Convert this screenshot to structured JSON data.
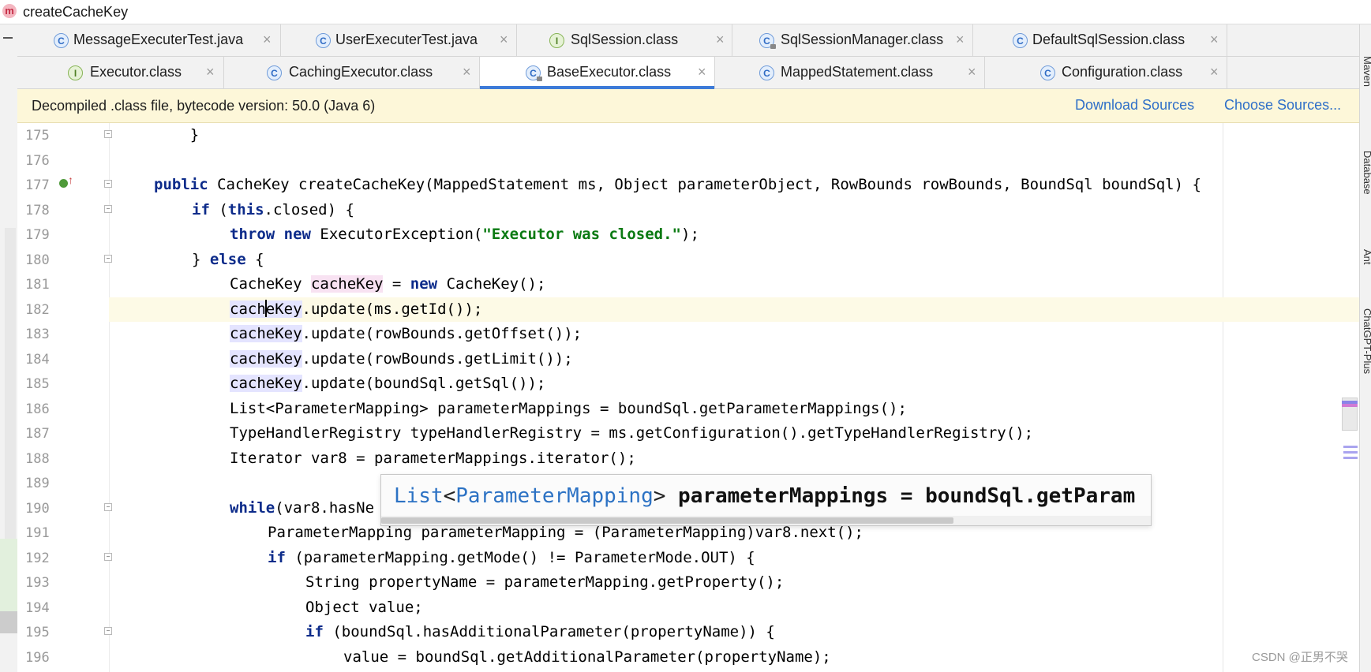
{
  "breadcrumb": {
    "icon_letter": "m",
    "text": "createCacheKey"
  },
  "tab_row_1": [
    {
      "label": "MessageExecuterTest.java",
      "icon": "c",
      "close": "×"
    },
    {
      "label": "UserExecuterTest.java",
      "icon": "c",
      "close": "×"
    },
    {
      "label": "SqlSession.class",
      "icon": "i",
      "close": "×"
    },
    {
      "label": "SqlSessionManager.class",
      "icon": "c",
      "close": "×"
    },
    {
      "label": "DefaultSqlSession.class",
      "icon": "c",
      "close": "×"
    }
  ],
  "tab_row_2": [
    {
      "label": "Executor.class",
      "icon": "i",
      "close": "×"
    },
    {
      "label": "CachingExecutor.class",
      "icon": "c",
      "close": "×"
    },
    {
      "label": "BaseExecutor.class",
      "icon": "c",
      "close": "×",
      "active": true
    },
    {
      "label": "MappedStatement.class",
      "icon": "c",
      "close": "×"
    },
    {
      "label": "Configuration.class",
      "icon": "c",
      "close": "×"
    }
  ],
  "banner": {
    "text": "Decompiled .class file, bytecode version: 50.0 (Java 6)",
    "download_sources": "Download Sources",
    "choose_sources": "Choose Sources..."
  },
  "right_tools": [
    "Maven",
    "Database",
    "Ant",
    "ChatGPT-Plus"
  ],
  "line_numbers": [
    "175",
    "176",
    "177",
    "178",
    "179",
    "180",
    "181",
    "182",
    "183",
    "184",
    "185",
    "186",
    "187",
    "188",
    "189",
    "190",
    "191",
    "192",
    "193",
    "194",
    "195",
    "196"
  ],
  "code": {
    "l175": "    }",
    "l177_kw": "public",
    "l177_rest": " CacheKey createCacheKey(MappedStatement ms, Object parameterObject, RowBounds rowBounds, BoundSql boundSql) {",
    "l178_kw1": "if",
    "l178_mid": " (",
    "l178_kw2": "this",
    "l178_rest": ".closed) {",
    "l179_kw1": "throw",
    "l179_kw2": "new",
    "l179_mid": " ExecutorException(",
    "l179_str": "\"Executor was closed.\"",
    "l179_end": ");",
    "l180_pre": "} ",
    "l180_kw": "else",
    "l180_rest": " {",
    "l181_pre": "CacheKey ",
    "l181_var": "cacheKey",
    "l181_mid": " = ",
    "l181_kw": "new",
    "l181_rest": " CacheKey();",
    "l182_var_a": "cach",
    "l182_var_b": "eKey",
    "l182_rest": ".update(ms.getId());",
    "l183_var": "cacheKey",
    "l183_rest": ".update(rowBounds.getOffset());",
    "l184_var": "cacheKey",
    "l184_rest": ".update(rowBounds.getLimit());",
    "l185_var": "cacheKey",
    "l185_rest": ".update(boundSql.getSql());",
    "l186": "List<ParameterMapping> parameterMappings = boundSql.getParameterMappings();",
    "l187": "TypeHandlerRegistry typeHandlerRegistry = ms.getConfiguration().getTypeHandlerRegistry();",
    "l188": "Iterator var8 = parameterMappings.iterator();",
    "l190_kw": "while",
    "l190_rest": "(var8.hasNe",
    "l191": "ParameterMapping parameterMapping = (ParameterMapping)var8.next();",
    "l192_kw": "if",
    "l192_rest": " (parameterMapping.getMode() != ParameterMode.OUT) {",
    "l193": "String propertyName = parameterMapping.getProperty();",
    "l194": "Object value;",
    "l195_kw": "if",
    "l195_rest": " (boundSql.hasAdditionalParameter(propertyName)) {",
    "l196": "value = boundSql.getAdditionalParameter(propertyName);"
  },
  "tooltip": {
    "type_a": "List",
    "lt": "<",
    "type_b": "ParameterMapping",
    "gt": ">",
    "rest": " parameterMappings = boundSql.getParam"
  },
  "watermark": "CSDN @正男不哭",
  "colors": {
    "keyword": "#0c2b8a",
    "string": "#0a7a12",
    "link": "#2f6fc8",
    "banner_bg": "#fdf7d9",
    "active_tab_underline": "#3d7bd8"
  }
}
